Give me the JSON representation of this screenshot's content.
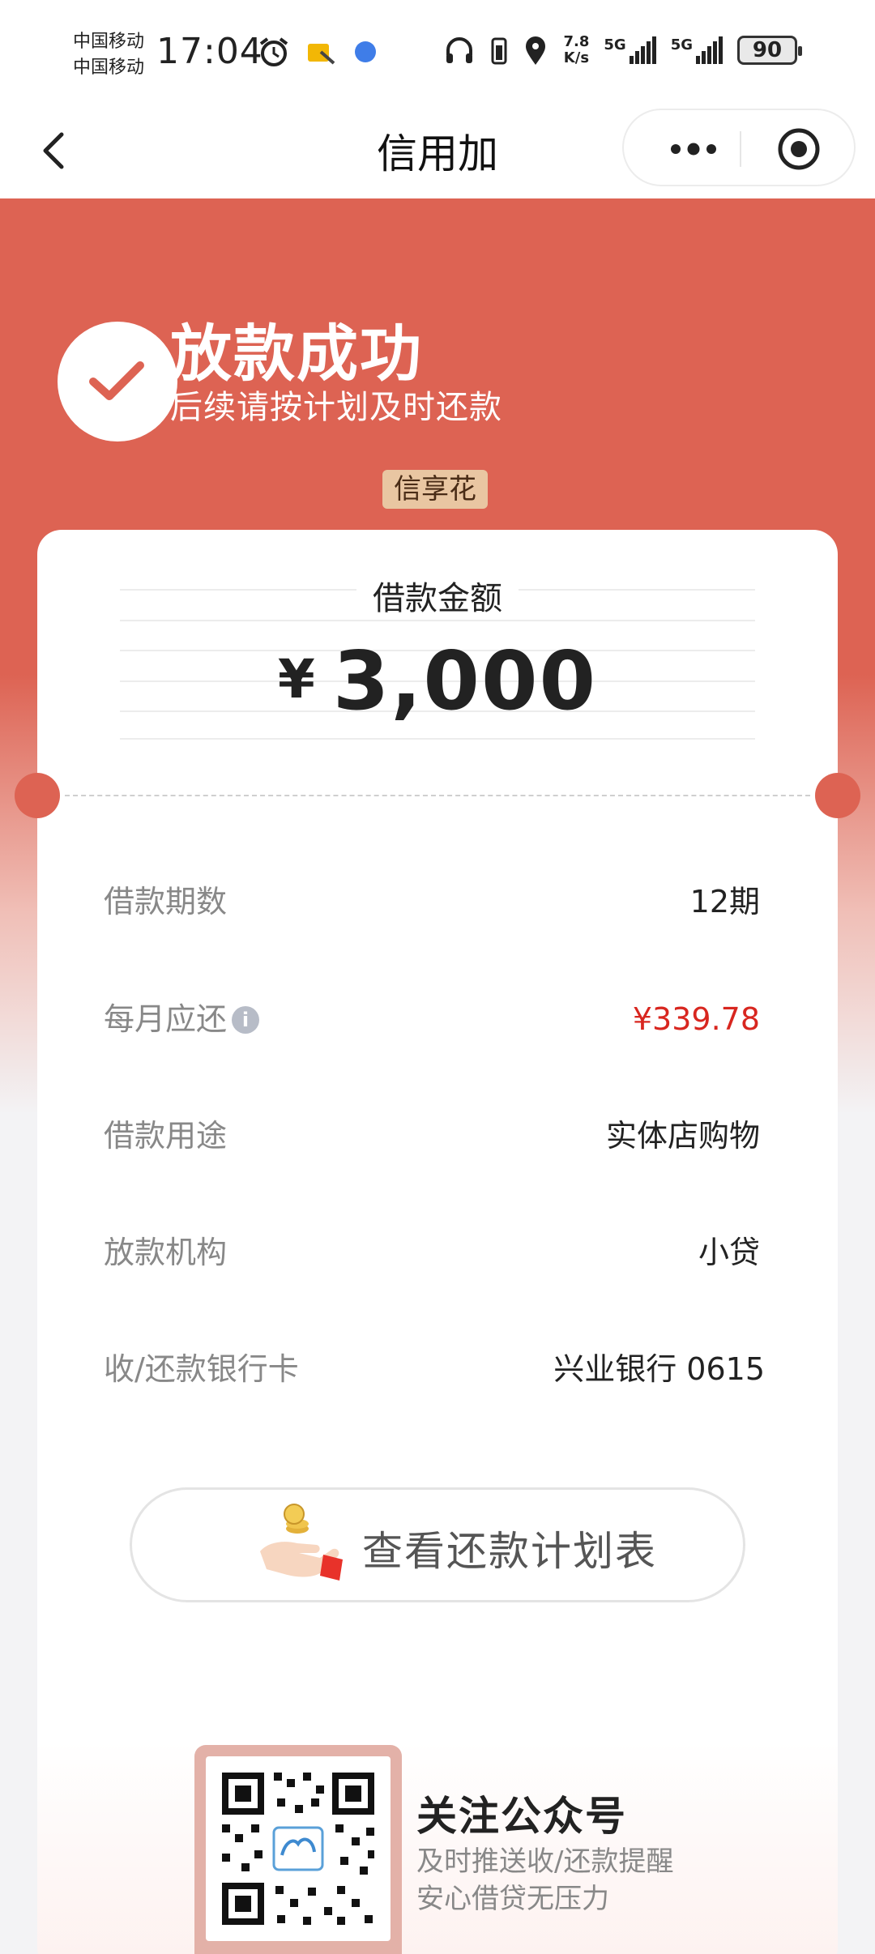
{
  "status_bar": {
    "carrier_1": "中国移动",
    "carrier_2": "中国移动",
    "time": "17:04",
    "net_speed_value": "7.8",
    "net_speed_unit": "K/s",
    "signal_1_label": "5G",
    "signal_2_label": "5G",
    "battery": "90"
  },
  "nav": {
    "title": "信用加"
  },
  "success": {
    "title": "放款成功",
    "subtitle": "后续请按计划及时还款",
    "product_tag": "信享花"
  },
  "loan": {
    "amount_label": "借款金额",
    "currency": "¥",
    "amount": "3,000"
  },
  "details": [
    {
      "key": "借款期数",
      "value": "12期",
      "highlight": false
    },
    {
      "key": "每月应还",
      "value": "¥339.78",
      "highlight": true,
      "info_icon": "i"
    },
    {
      "key": "借款用途",
      "value": "实体店购物",
      "highlight": false
    },
    {
      "key": "放款机构",
      "value": "小贷",
      "highlight": false
    },
    {
      "key": "收/还款银行卡",
      "value": "兴业银行 0615",
      "highlight": false
    }
  ],
  "plan_button": {
    "label": "查看还款计划表",
    "icon": "hand-coin-icon"
  },
  "follow": {
    "title": "关注公众号",
    "line1": "及时推送收/还款提醒",
    "line2": "安心借贷无压力"
  },
  "colors": {
    "brand_red": "#dd6353",
    "amount_red": "#d8261f",
    "tag_bg": "#e9c6a2"
  }
}
